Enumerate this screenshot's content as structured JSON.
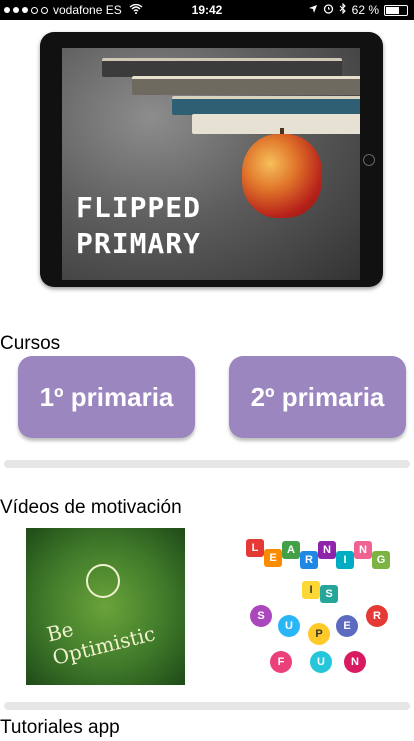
{
  "status_bar": {
    "carrier": "vodafone ES",
    "time": "19:42",
    "battery": "62 %",
    "icons": [
      "wifi-icon",
      "location-icon",
      "alarm-icon",
      "bluetooth-icon",
      "battery-icon"
    ]
  },
  "hero": {
    "title_line1": "FLIPPED",
    "title_line2": "PRIMARY"
  },
  "sections": {
    "courses_title": "Cursos",
    "courses": [
      {
        "label": "1º primaria"
      },
      {
        "label": "2º primaria"
      }
    ],
    "videos_title": "Vídeos de motivación",
    "video1_caption": "Be Optimistic",
    "video2_letters_learning": [
      "L",
      "E",
      "A",
      "R",
      "N",
      "I",
      "N",
      "G"
    ],
    "video2_letters_is": [
      "I",
      "S"
    ],
    "video2_letters_super": [
      "S",
      "U",
      "P",
      "E",
      "R"
    ],
    "video2_letters_fun": [
      "F",
      "U",
      "N"
    ],
    "tutorials_title": "Tutoriales app"
  },
  "colors": {
    "button": "#9b86bf",
    "divider": "#e6e6e6"
  }
}
